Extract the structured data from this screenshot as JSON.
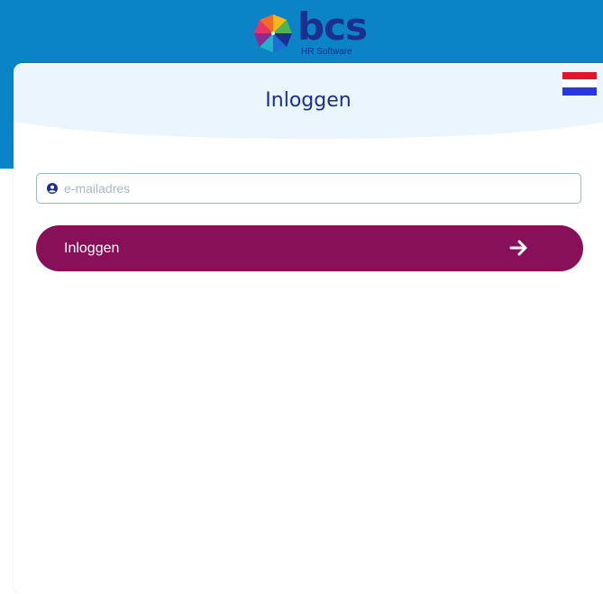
{
  "brand": {
    "name": "bcs",
    "tagline": "HR Software",
    "logo_icon": "pinwheel-logo-icon",
    "colors": {
      "primary_blue": "#0a84c6",
      "navy": "#1b2f8f",
      "button_purple": "#871058"
    }
  },
  "login_card": {
    "title": "Inloggen",
    "language_flag": "dutch-flag-icon",
    "email_field": {
      "value": "",
      "placeholder": "e-mailadres",
      "icon": "user-icon"
    },
    "submit_button": {
      "label": "Inloggen",
      "icon": "arrow-right-icon"
    }
  }
}
